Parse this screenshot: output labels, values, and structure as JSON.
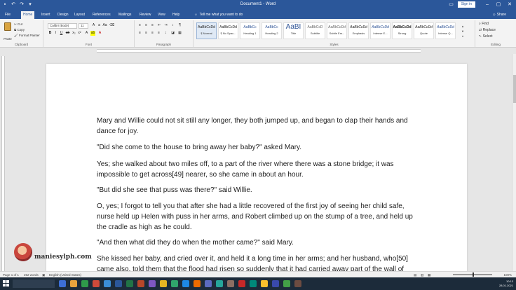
{
  "window": {
    "title": "Document1 - Word",
    "signin": "Sign in",
    "share": "Share"
  },
  "tabs": [
    "File",
    "Home",
    "Insert",
    "Design",
    "Layout",
    "References",
    "Mailings",
    "Review",
    "View",
    "Help"
  ],
  "tell_me": "Tell me what you want to do",
  "ribbon": {
    "clipboard": {
      "label": "Clipboard",
      "paste": "Paste",
      "cut": "Cut",
      "copy": "Copy",
      "format_painter": "Format Painter"
    },
    "font": {
      "label": "Font",
      "family": "Calibri (Body)",
      "size": "11"
    },
    "paragraph": {
      "label": "Paragraph"
    },
    "styles": {
      "label": "Styles",
      "items": [
        {
          "preview": "AaBbCcDd",
          "name": "¶ Normal"
        },
        {
          "preview": "AaBbCcDd",
          "name": "¶ No Spac..."
        },
        {
          "preview": "AaBbCc",
          "name": "Heading 1"
        },
        {
          "preview": "AaBbCc",
          "name": "Heading 2"
        },
        {
          "preview": "AaBI",
          "name": "Title"
        },
        {
          "preview": "AaBbCcD",
          "name": "Subtitle"
        },
        {
          "preview": "AaBbCcDd",
          "name": "Subtle Em..."
        },
        {
          "preview": "AaBbCcDd",
          "name": "Emphasis"
        },
        {
          "preview": "AaBbCcDd",
          "name": "Intense E..."
        },
        {
          "preview": "AaBbCcDd",
          "name": "Strong"
        },
        {
          "preview": "AaBbCcDd",
          "name": "Quote"
        },
        {
          "preview": "AaBbCcDd",
          "name": "Intense Q..."
        }
      ]
    },
    "editing": {
      "label": "Editing",
      "find": "Find",
      "replace": "Replace",
      "select": "Select"
    }
  },
  "document": {
    "paragraphs": [
      "Mary and Willie could not sit still any longer, they both jumped up, and began to clap their hands and dance for joy.",
      "\"Did she come to the house to bring away her baby?\" asked Mary.",
      "Yes; she walked about two miles off, to a part of the river where there was a stone bridge; it was impossible to get across[49] nearer, so she came in about an hour.",
      "\"But did she see that puss was there?\" said Willie.",
      "O, yes; I forgot to tell you that after she had a little recovered of the first joy of seeing her child safe, nurse held up Helen with puss in her arms, and Robert climbed up on the stump of a tree, and held up the cradle as high as he could.",
      "\"And then what did they do when the mother came?\" said Mary.",
      "She kissed her baby, and cried over it, and held it a long time in her arms; and her husband, who[50] came also, told them that the flood had risen so suddenly that it had carried away part of the wall of"
    ]
  },
  "watermark": {
    "text": "maniesylph.com"
  },
  "status": {
    "page": "Page 1 of 1",
    "words": "252 words",
    "language": "English (United States)",
    "zoom": "100%"
  },
  "taskbar": {
    "time": "10:13",
    "date": "28.01.2021"
  }
}
